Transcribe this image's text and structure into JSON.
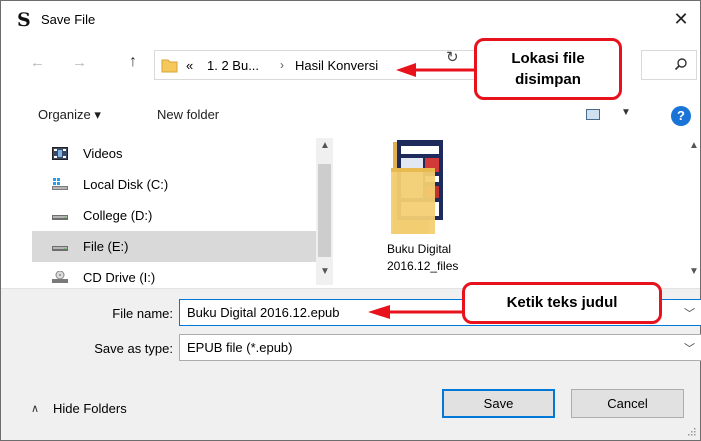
{
  "window": {
    "title": "Save File"
  },
  "address": {
    "overflow": "«",
    "crumbs": [
      "1. 2 Bu...",
      "Hasil Konversi"
    ],
    "separator": "›"
  },
  "toolbar": {
    "organize_label": "Organize ▾",
    "new_folder_label": "New folder"
  },
  "nav": {
    "items": [
      {
        "label": "Videos"
      },
      {
        "label": "Local Disk (C:)"
      },
      {
        "label": "College (D:)"
      },
      {
        "label": "File (E:)"
      },
      {
        "label": "CD Drive (I:)"
      }
    ]
  },
  "files": [
    {
      "label_line1": "Buku Digital",
      "label_line2": "2016.12_files"
    }
  ],
  "form": {
    "filename_label": "File name:",
    "filename_value": "Buku Digital 2016.12.epub",
    "savetype_label": "Save as type:",
    "savetype_value": "EPUB file (*.epub)"
  },
  "footer": {
    "hide_folders_label": "Hide Folders"
  },
  "buttons": {
    "save_label": "Save",
    "cancel_label": "Cancel"
  },
  "annotations": {
    "location_line1": "Lokasi file",
    "location_line2": "disimpan",
    "title_hint": "Ketik teks judul"
  },
  "colors": {
    "accent": "#0078d7",
    "annotation_red": "#e8121d",
    "help_blue": "#1a73d6"
  }
}
